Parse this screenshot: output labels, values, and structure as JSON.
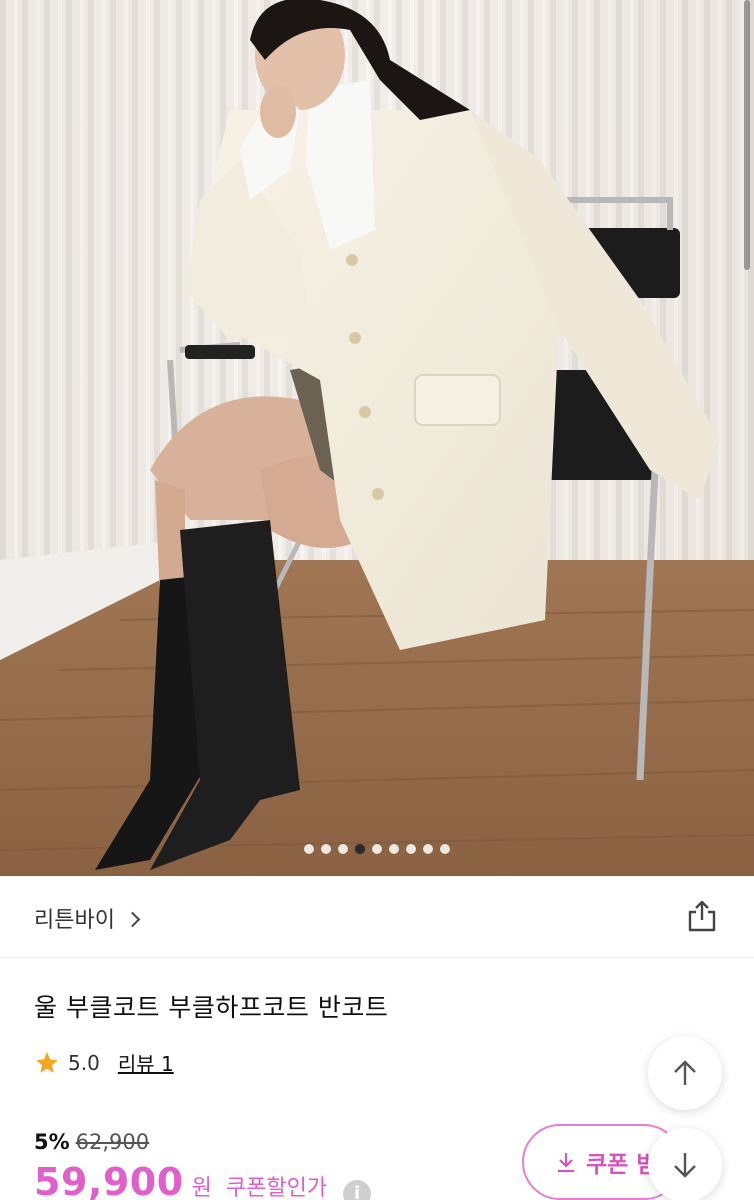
{
  "store": {
    "name": "리튼바이"
  },
  "product": {
    "title": "울 부클코트 부클하프코트 반코트",
    "rating": "5.0",
    "review_label": "리뷰 1",
    "discount": "5%",
    "original_price": "62,900",
    "price": "59,900",
    "currency": "원",
    "coupon_price_label": "쿠폰할인가",
    "info": "i"
  },
  "coupon_button": {
    "label": "쿠폰 받"
  },
  "carousel": {
    "count": 9,
    "active_index": 3
  },
  "colors": {
    "accent": "#e15fcb",
    "star": "#f2a623"
  }
}
